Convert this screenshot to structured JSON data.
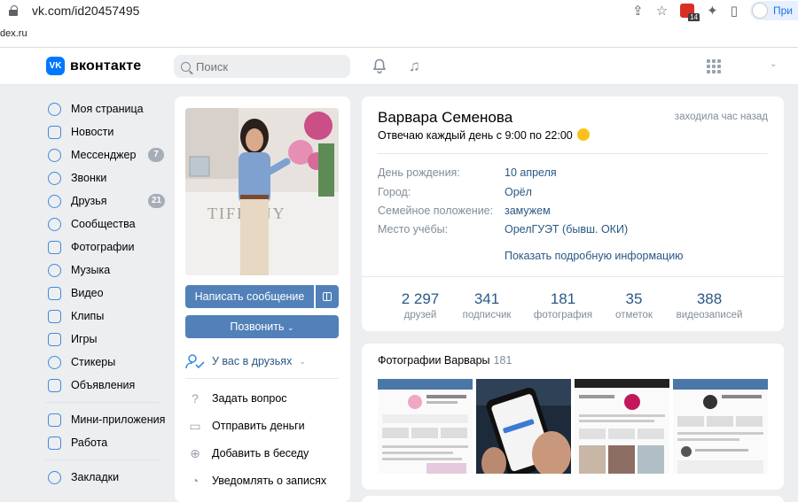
{
  "browser": {
    "url": "vk.com/id20457495",
    "bookmark_text": "dex.ru",
    "ext_badge": "14",
    "profile_label": "При"
  },
  "header": {
    "logo_text": "вконтакте",
    "logo_box": "VK",
    "search_placeholder": "Поиск"
  },
  "menu": {
    "items": [
      {
        "label": "Моя страница"
      },
      {
        "label": "Новости"
      },
      {
        "label": "Мессенджер",
        "badge": "7"
      },
      {
        "label": "Звонки"
      },
      {
        "label": "Друзья",
        "badge": "21"
      },
      {
        "label": "Сообщества"
      },
      {
        "label": "Фотографии"
      },
      {
        "label": "Музыка"
      },
      {
        "label": "Видео"
      },
      {
        "label": "Клипы"
      },
      {
        "label": "Игры"
      },
      {
        "label": "Стикеры"
      },
      {
        "label": "Объявления"
      }
    ],
    "items2": [
      {
        "label": "Мини-приложения"
      },
      {
        "label": "Работа"
      }
    ],
    "items3": [
      {
        "label": "Закладки"
      }
    ]
  },
  "profile": {
    "write_message": "Написать сообщение",
    "call": "Позвонить",
    "friend_status": "У вас в друзьях",
    "actions": [
      {
        "label": "Задать вопрос"
      },
      {
        "label": "Отправить деньги"
      },
      {
        "label": "Добавить в беседу"
      },
      {
        "label": "Уведомлять о записях"
      }
    ],
    "photo_sign": "TIFFANY"
  },
  "info": {
    "name": "Варвара Семенова",
    "last_seen": "заходила час назад",
    "status": "Отвечаю каждый день с 9:00 по 22:00",
    "rows": [
      {
        "label": "День рождения:",
        "value": "10 апреля"
      },
      {
        "label": "Город:",
        "value": "Орёл"
      },
      {
        "label": "Семейное положение:",
        "value": "замужем"
      },
      {
        "label": "Место учёбы:",
        "value": "ОрелГУЭТ (бывш. ОКИ)"
      }
    ],
    "show_more": "Показать подробную информацию",
    "counters": [
      {
        "num": "2 297",
        "label": "друзей"
      },
      {
        "num": "341",
        "label": "подписчик"
      },
      {
        "num": "181",
        "label": "фотография"
      },
      {
        "num": "35",
        "label": "отметок"
      },
      {
        "num": "388",
        "label": "видеозаписей"
      }
    ]
  },
  "photos": {
    "title": "Фотографии Варвары",
    "count": "181"
  },
  "colors": {
    "accent": "#5181b8",
    "link": "#2a5885",
    "bg": "#edeef0"
  }
}
